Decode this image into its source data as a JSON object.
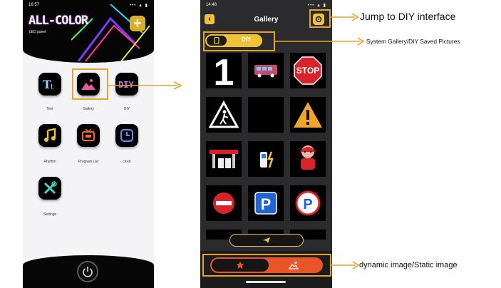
{
  "home": {
    "time": "16:57",
    "status_icons": "••• ▲ ▮",
    "logo": "ALL-COLOR",
    "subtitle": "LED panel",
    "add_icon": "plus-icon",
    "apps": [
      {
        "label": "Text",
        "icon": "text-icon"
      },
      {
        "label": "Gallery",
        "icon": "gallery-icon"
      },
      {
        "label": "DIY",
        "icon": "diy-icon"
      },
      {
        "label": "Rhythm",
        "icon": "music-note-icon"
      },
      {
        "label": "Program List",
        "icon": "tv-icon"
      },
      {
        "label": "clock",
        "icon": "clock-icon"
      },
      {
        "label": "Settings",
        "icon": "tools-icon"
      }
    ],
    "power_icon": "power-icon"
  },
  "gallery": {
    "time": "14:48",
    "status_icons": "••• ▲ ▮",
    "title": "Gallery",
    "toggle_diy": "DIY",
    "tiles": [
      "number-one",
      "bus",
      "stop-sign",
      "pedestrian-warning",
      "blank",
      "warning-triangle",
      "gas-station",
      "charging-station",
      "baby-seat",
      "no-entry",
      "parking",
      "parking-round"
    ],
    "mode_icons": [
      "star-icon",
      "mountain-image-icon"
    ]
  },
  "annotations": {
    "diy": "Jump to DIY interface",
    "system_gallery": "System Gallery/DIY Saved Pictures",
    "mode": "dynamic image/Static image"
  },
  "colors": {
    "accent": "#e6a32c",
    "button_gold": "#f0c23a",
    "mode_orange": "#ea5528"
  }
}
